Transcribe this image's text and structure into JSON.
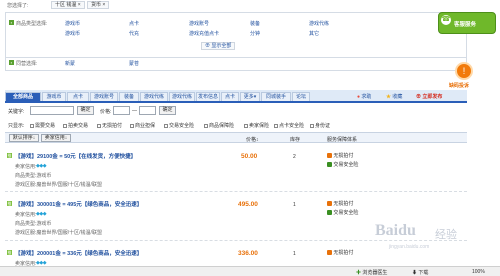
{
  "top_filter": {
    "label": "您选择了:",
    "chip1": "十区 钱温",
    "chip2": "货币"
  },
  "categories": {
    "label": "商品类型选择:",
    "items_row1": [
      "游戏币",
      "点卡",
      "游戏账号",
      "装备",
      "游戏代练"
    ],
    "items_row2": [
      "游戏币",
      "代充",
      "游戏充值点卡",
      "分钟",
      "其它"
    ],
    "more": "显示全部"
  },
  "trade": {
    "label": "同营选择:",
    "opt1": "新蒙",
    "opt2": "蒙苍"
  },
  "tabs": [
    "全部商品",
    "游戏币",
    "点卡",
    "游戏账号",
    "装备",
    "游戏代练",
    "游戏代练",
    "发布信息",
    "点卡",
    "更多",
    "同城装手",
    "论坛"
  ],
  "right_links": {
    "help": "求助",
    "collect": "收藏",
    "publish": "立即发布"
  },
  "search": {
    "keyword_label": "关键字:",
    "confirm": "确定",
    "price_label": "价格:",
    "dash": "—",
    "confirm2": "确定"
  },
  "filters": {
    "label": "只显示:",
    "options": [
      "需要交易",
      "拍卖交易",
      "无损拍付",
      "商业担保",
      "交易安全险",
      "商品保障险",
      "卖家保险",
      "点卡安全险",
      "身份证"
    ]
  },
  "table_head": {
    "sort1": "默认排序",
    "sort2": "卖家信用",
    "col_price": "价格",
    "col_stock": "库存",
    "col_service": "服务保障体系"
  },
  "listings": [
    {
      "tag": "推",
      "title": "【游戏】29100金 = 50元【在线发货，方便快捷】",
      "seller_label": "卖家信用:",
      "detail_label": "商品类型:",
      "detail_value": "游戏币",
      "loc_label": "游戏区服:",
      "loc_value": "魔兽世界/国服/十区/钱温/联盟",
      "price": "50.00",
      "stock": "2",
      "service1": "无损拍付",
      "service2": "交易安全险"
    },
    {
      "tag": "推",
      "title": "【游戏】300001金 = 495元【绿色商品，安全迅速】",
      "seller_label": "卖家信用:",
      "detail_label": "商品类型:",
      "detail_value": "游戏币",
      "loc_label": "游戏区服:",
      "loc_value": "魔兽世界/国服/十区/钱温/联盟",
      "price": "495.00",
      "stock": "1",
      "service1": "无损拍付",
      "service2": "交易安全险"
    },
    {
      "tag": "推",
      "title": "【游戏】200001金 = 336元【绿色商品，安全迅速】",
      "seller_label": "卖家信用:",
      "detail_label": "",
      "detail_value": "",
      "loc_label": "",
      "loc_value": "",
      "price": "336.00",
      "stock": "1",
      "service1": "无损拍付",
      "service2": ""
    }
  ],
  "sidebar": {
    "badge1": "客服服务",
    "badge2": "缺码投诉"
  },
  "watermark": {
    "brand": "Baidu",
    "cn": "经验",
    "url": "jingyan.baidu.com"
  },
  "statusbar": {
    "left": "浏览器医生",
    "mid": "下载",
    "zoom": "100%"
  },
  "colors": {
    "accent_blue": "#2a5eb8",
    "price_orange": "#e8710a",
    "badge_orange": "#f27a0a",
    "badge_green": "#6fb82a"
  }
}
